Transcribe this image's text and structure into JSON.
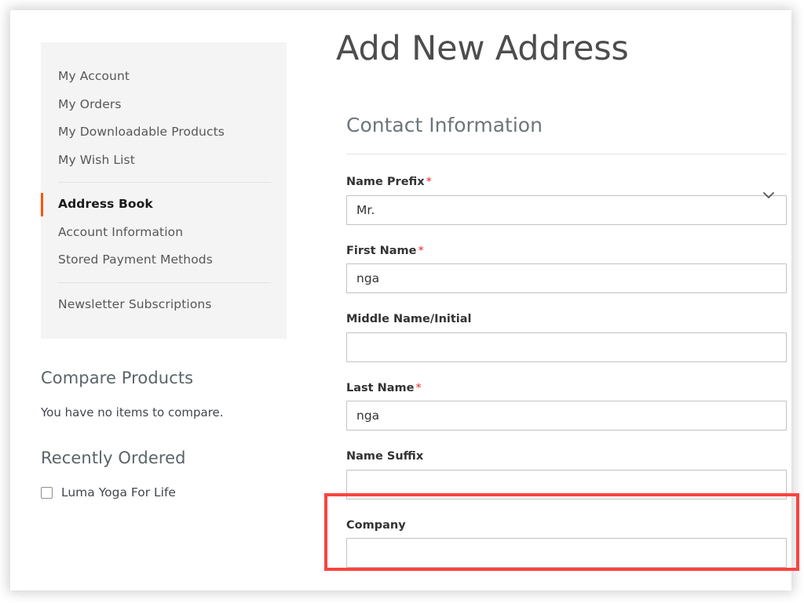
{
  "sidebar": {
    "nav_items": [
      {
        "label": "My Account",
        "current": false
      },
      {
        "label": "My Orders",
        "current": false
      },
      {
        "label": "My Downloadable Products",
        "current": false
      },
      {
        "label": "My Wish List",
        "current": false
      },
      {
        "label": "Address Book",
        "current": true
      },
      {
        "label": "Account Information",
        "current": false
      },
      {
        "label": "Stored Payment Methods",
        "current": false
      },
      {
        "label": "Newsletter Subscriptions",
        "current": false
      }
    ],
    "compare": {
      "title": "Compare Products",
      "empty_text": "You have no items to compare."
    },
    "recently_ordered": {
      "title": "Recently Ordered",
      "items": [
        {
          "label": "Luma Yoga For Life",
          "checked": false
        }
      ]
    }
  },
  "main": {
    "title": "Add New Address",
    "legend": "Contact Information",
    "fields": [
      {
        "label": "Name Prefix",
        "required": true,
        "type": "select",
        "value": "Mr.",
        "placeholder": "",
        "icon": "chevron-down-icon"
      },
      {
        "label": "First Name",
        "required": true,
        "type": "text",
        "value": "nga",
        "placeholder": ""
      },
      {
        "label": "Middle Name/Initial",
        "required": false,
        "type": "text",
        "value": "",
        "placeholder": ""
      },
      {
        "label": "Last Name",
        "required": true,
        "type": "text",
        "value": "nga",
        "placeholder": ""
      },
      {
        "label": "Name Suffix",
        "required": false,
        "type": "text",
        "value": "",
        "placeholder": ""
      },
      {
        "label": "Company",
        "required": false,
        "type": "text",
        "value": "",
        "placeholder": ""
      }
    ]
  },
  "annotation": {
    "color": "#f8443f",
    "target": "Name Suffix"
  },
  "colors": {
    "accent_orange": "#ff5501",
    "required_red": "#e02b27",
    "nav_background": "#f4f4f4",
    "highlight_red": "#f8443f"
  },
  "required_marker": "*"
}
